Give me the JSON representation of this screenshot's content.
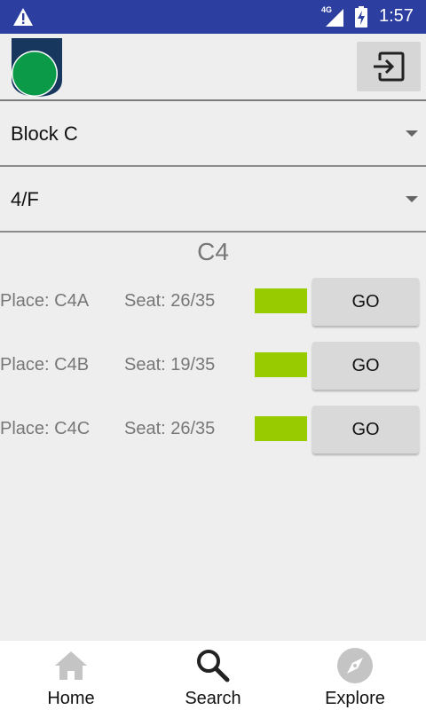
{
  "status_bar": {
    "network": "4G",
    "time": "1:57"
  },
  "icons": {
    "warning": "warning-icon",
    "signal": "signal-icon",
    "battery": "battery-charging-icon",
    "logout": "logout-icon",
    "home": "home-icon",
    "search": "search-icon",
    "explore": "compass-icon"
  },
  "colors": {
    "status_bar": "#2c3ea0",
    "logo_shield": "#17375e",
    "logo_circle": "#0a9a48",
    "availability": "#99cc00",
    "button": "#d9d9d9"
  },
  "filters": {
    "block": "Block C",
    "floor": "4/F"
  },
  "section_title": "C4",
  "rows": [
    {
      "place": "Place: C4A",
      "seat": "Seat: 26/35",
      "button": "GO"
    },
    {
      "place": "Place: C4B",
      "seat": "Seat: 19/35",
      "button": "GO"
    },
    {
      "place": "Place: C4C",
      "seat": "Seat: 26/35",
      "button": "GO"
    }
  ],
  "bottom_nav": {
    "home": "Home",
    "search": "Search",
    "explore": "Explore"
  }
}
